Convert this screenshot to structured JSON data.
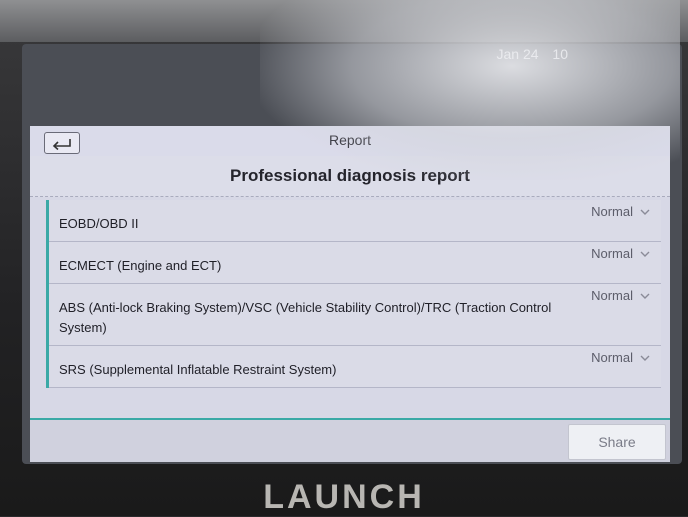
{
  "statusbar": {
    "date": "Jan 24",
    "time_partial": "10"
  },
  "header": {
    "title": "Report",
    "back_icon": "return-arrow-icon"
  },
  "report": {
    "title": "Professional diagnosis report"
  },
  "systems": [
    {
      "label": "EOBD/OBD II",
      "status": "Normal"
    },
    {
      "label": "ECMECT (Engine and ECT)",
      "status": "Normal"
    },
    {
      "label": "ABS (Anti-lock Braking System)/VSC (Vehicle Stability Control)/TRC (Traction Control System)",
      "status": "Normal"
    },
    {
      "label": "SRS (Supplemental Inflatable Restraint System)",
      "status": "Normal"
    }
  ],
  "footer": {
    "share_label": "Share"
  },
  "device": {
    "brand": "LAUNCH"
  },
  "colors": {
    "accent": "#3aa9a6",
    "panel": "#d7d8e6"
  }
}
